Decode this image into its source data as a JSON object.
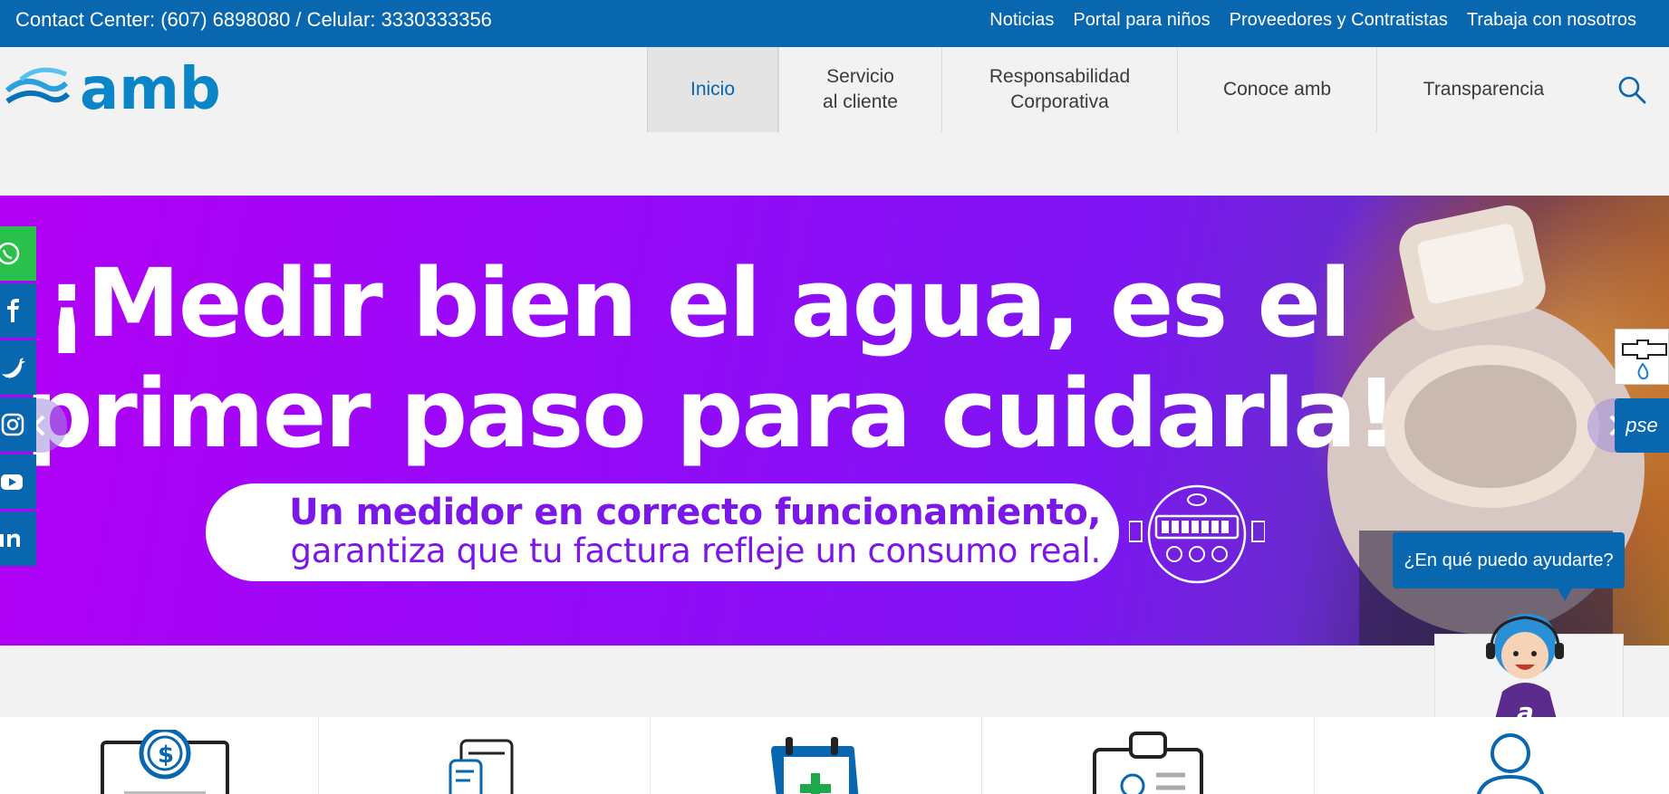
{
  "topbar": {
    "contact": "Contact Center: (607) 6898080 / Celular: 3330333356",
    "links": [
      "Noticias",
      "Portal para niños",
      "Proveedores y Contratistas",
      "Trabaja con nosotros"
    ]
  },
  "header": {
    "logo_text": "amb",
    "nav": [
      {
        "label": "Inicio",
        "active": true
      },
      {
        "label": "Servicio\nal cliente"
      },
      {
        "label": "Responsabilidad\nCorporativa"
      },
      {
        "label": "Conoce amb"
      },
      {
        "label": "Transparencia"
      }
    ],
    "search_icon": "search-icon"
  },
  "hero": {
    "headline_line1": "¡Medir bien el agua, es el",
    "headline_line2": "primer paso para cuidarla!",
    "pill_line1": "Un medidor en correcto funcionamiento,",
    "pill_line2": "garantiza que tu factura refleje un consumo real."
  },
  "social": [
    "whatsapp-icon",
    "facebook-icon",
    "twitter-icon",
    "instagram-icon",
    "youtube-icon",
    "linkedin-icon"
  ],
  "widgets": {
    "pse_label": "pse"
  },
  "chat": {
    "prompt": "¿En qué puedo ayudarte?",
    "avatar_letter": "a"
  },
  "services": [
    "payment-icon",
    "invoice-icon",
    "calendar-icon",
    "clipboard-icon",
    "user-icon"
  ],
  "colors": {
    "brand_blue": "#0867ae",
    "hero_purple": "#9a08f8",
    "whatsapp_green": "#29c04b"
  }
}
